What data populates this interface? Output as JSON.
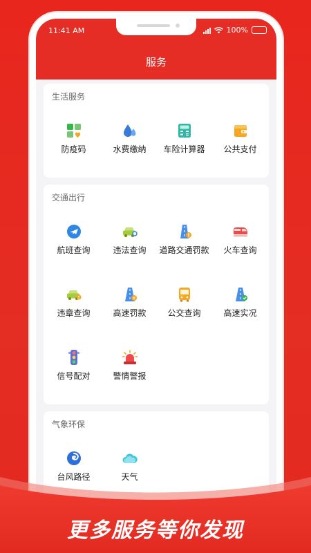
{
  "status_bar": {
    "time": "11:41 AM",
    "battery": "100%"
  },
  "header": {
    "title": "服务"
  },
  "sections": [
    {
      "title": "生活服务",
      "items": [
        {
          "label": "防疫码",
          "icon": "health-code-icon"
        },
        {
          "label": "水费缴纳",
          "icon": "water-drop-icon"
        },
        {
          "label": "车险计算器",
          "icon": "calculator-icon"
        },
        {
          "label": "公共支付",
          "icon": "wallet-icon"
        }
      ]
    },
    {
      "title": "交通出行",
      "items": [
        {
          "label": "航班查询",
          "icon": "plane-icon"
        },
        {
          "label": "违法查询",
          "icon": "car-search-icon"
        },
        {
          "label": "道路交通罚款",
          "icon": "road-fine-icon"
        },
        {
          "label": "火车查询",
          "icon": "train-icon"
        },
        {
          "label": "违章查询",
          "icon": "car-violation-icon"
        },
        {
          "label": "高速罚款",
          "icon": "highway-fine-icon"
        },
        {
          "label": "公交查询",
          "icon": "bus-icon"
        },
        {
          "label": "高速实况",
          "icon": "highway-live-icon"
        },
        {
          "label": "信号配对",
          "icon": "traffic-light-icon"
        },
        {
          "label": "警情警报",
          "icon": "alarm-icon"
        }
      ]
    },
    {
      "title": "气象环保",
      "items": [
        {
          "label": "台风路径",
          "icon": "typhoon-icon"
        },
        {
          "label": "天气",
          "icon": "cloud-icon"
        }
      ]
    }
  ],
  "banner": {
    "slogan": "更多服务等你发现"
  },
  "colors": {
    "primary": "#e62d25",
    "background": "#f4f4f6"
  }
}
